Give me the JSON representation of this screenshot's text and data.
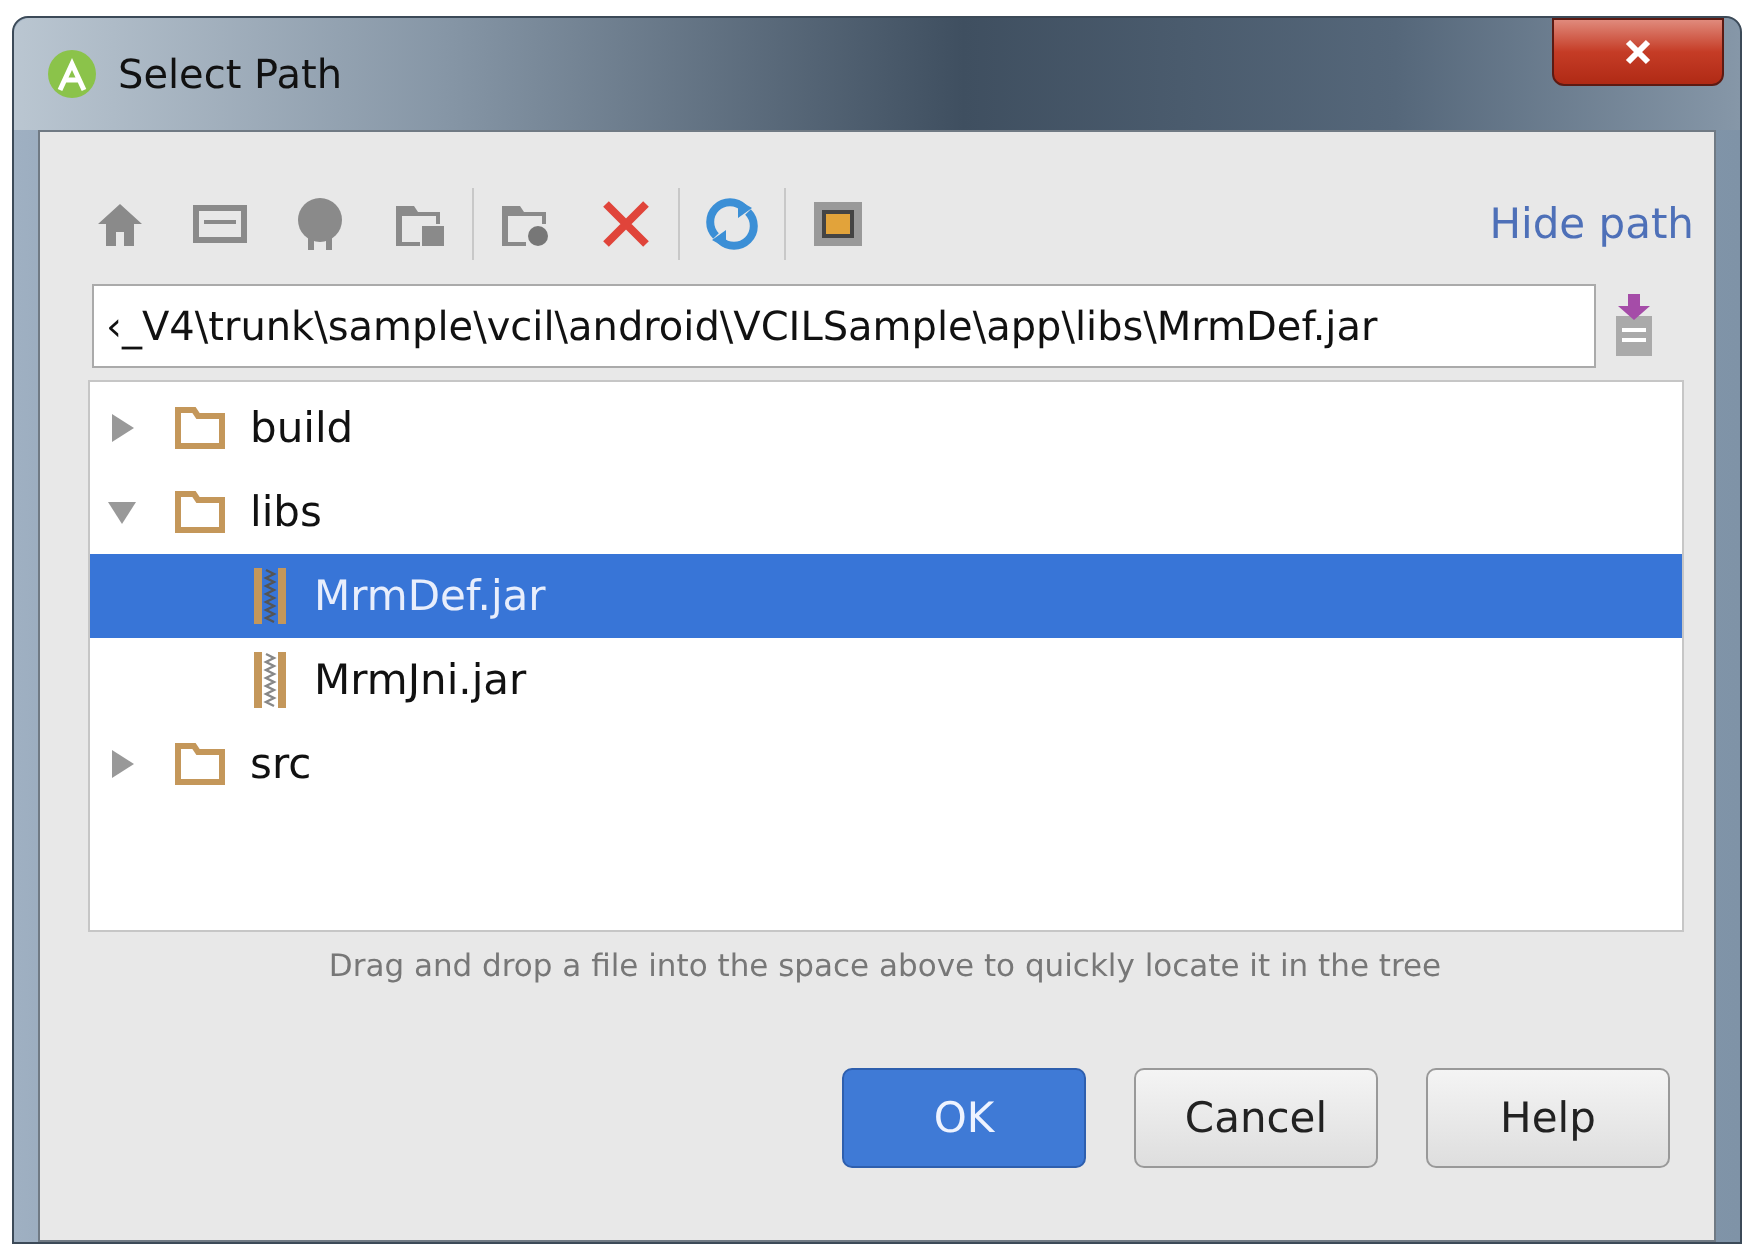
{
  "window": {
    "title": "Select Path"
  },
  "toolbar": {
    "link": "Hide path"
  },
  "path_field": {
    "value": "‹_V4\\trunk\\sample\\vcil\\android\\VCILSample\\app\\libs\\MrmDef.jar"
  },
  "tree": [
    {
      "name": "build",
      "kind": "folder",
      "expanded": false,
      "selected": false
    },
    {
      "name": "libs",
      "kind": "folder",
      "expanded": true,
      "selected": false,
      "children": [
        {
          "name": "MrmDef.jar",
          "kind": "jar",
          "selected": true
        },
        {
          "name": "MrmJni.jar",
          "kind": "jar",
          "selected": false
        }
      ]
    },
    {
      "name": "src",
      "kind": "folder",
      "expanded": false,
      "selected": false
    }
  ],
  "hint": "Drag and drop a file into the space above to quickly locate it in the tree",
  "buttons": [
    {
      "label": "OK",
      "kind": "default"
    },
    {
      "label": "Cancel",
      "kind": "normal"
    },
    {
      "label": "Help",
      "kind": "normal"
    }
  ]
}
